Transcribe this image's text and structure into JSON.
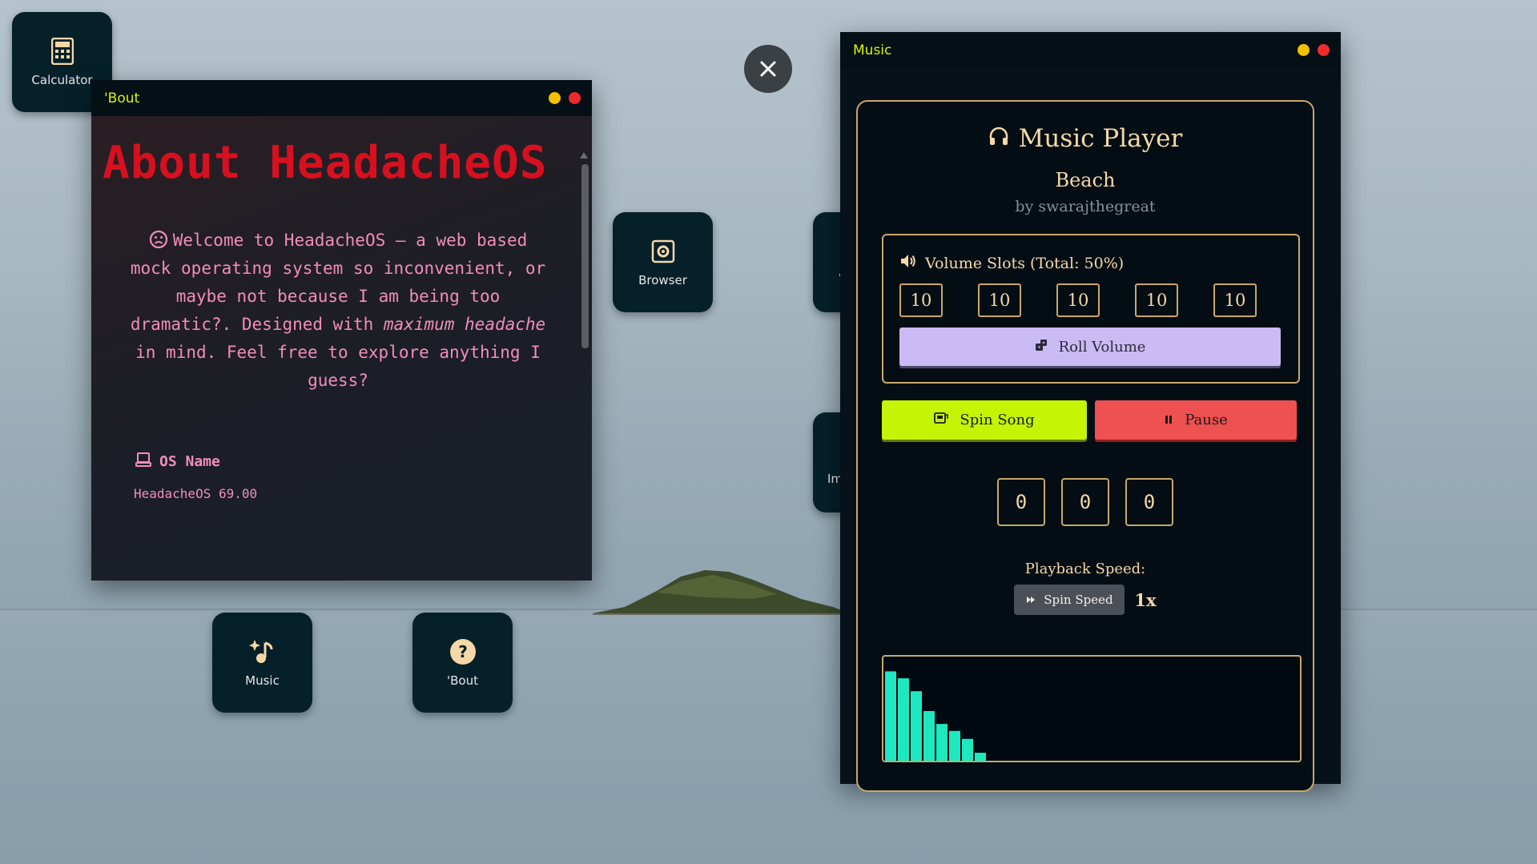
{
  "desktop_icons": {
    "calculator": "Calculator",
    "browser": "Browser",
    "music": "Music",
    "bout": "'Bout",
    "partial_1": "V",
    "partial_2": "Im"
  },
  "about_window": {
    "title": "'Bout",
    "heading": "About HeadacheOS",
    "welcome_part1": "Welcome to HeadacheOS — a web based mock operating system so inconvenient, or maybe not because I am being too dramatic?. Designed with ",
    "welcome_em": "maximum headache",
    "welcome_part2": " in mind. Feel free to explore anything I guess?",
    "os_name_label": "OS Name",
    "os_name_value": "HeadacheOS 69.00"
  },
  "music_window": {
    "title": "Music",
    "player_title": "Music Player",
    "song": "Beach",
    "artist": "by swarajthegreat",
    "volume_title": "Volume Slots (Total: 50%)",
    "volume_slots": [
      "10",
      "10",
      "10",
      "10",
      "10"
    ],
    "roll_label": "Roll Volume",
    "spin_song_label": "Spin Song",
    "pause_label": "Pause",
    "reels": [
      "0",
      "0",
      "0"
    ],
    "playback_speed_label": "Playback Speed:",
    "spin_speed_label": "Spin Speed",
    "speed_value": "1x",
    "visualizer_levels": [
      0.9,
      0.83,
      0.7,
      0.5,
      0.37,
      0.3,
      0.22,
      0.08
    ]
  },
  "colors": {
    "accent_title": "#d8f500",
    "heading_red": "#d7101f",
    "pink_text": "#f28dbb",
    "gold": "#c8a86a",
    "spin_green": "#c5f404",
    "pause_red": "#ef5050",
    "roll_lavender": "#cbbbf4",
    "visualizer": "#1ee8c0"
  }
}
